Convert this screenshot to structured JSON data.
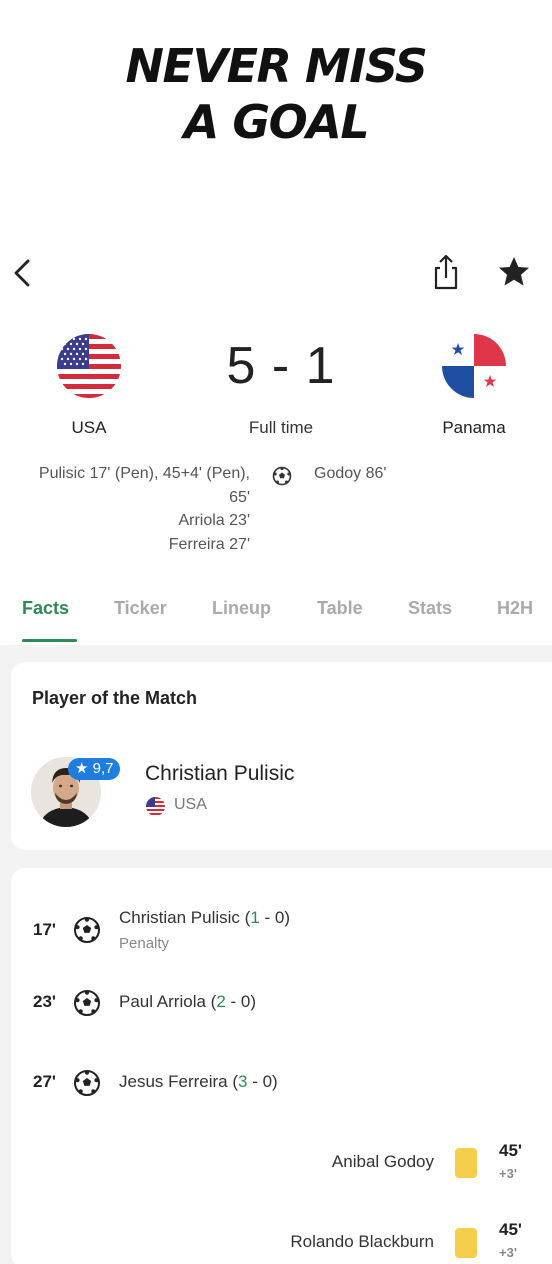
{
  "headline": {
    "line1": "NEVER MISS",
    "line2": "A GOAL"
  },
  "nav": {
    "back_icon": "chevron-left-icon",
    "share_icon": "share-icon",
    "favorite_icon": "star-icon"
  },
  "match": {
    "home_team": "USA",
    "away_team": "Panama",
    "score": "5 - 1",
    "status": "Full time",
    "home_scorers": [
      "Pulisic 17' (Pen), 45+4' (Pen),",
      "65'",
      "Arriola 23'",
      "Ferreira 27'"
    ],
    "away_scorers": [
      "Godoy 86'"
    ]
  },
  "tabs": [
    "Facts",
    "Ticker",
    "Lineup",
    "Table",
    "Stats",
    "H2H"
  ],
  "active_tab": "Facts",
  "player_of_match": {
    "title": "Player of the Match",
    "rating": "★ 9,7",
    "name": "Christian Pulisic",
    "country": "USA"
  },
  "events": [
    {
      "minute": "17'",
      "player": "Christian Pulisic",
      "open": " (",
      "score_home": "1",
      "score_rest": " - 0)",
      "detail": "Penalty"
    },
    {
      "minute": "23'",
      "player": "Paul Arriola",
      "open": " (",
      "score_home": "2",
      "score_rest": " - 0)",
      "detail": ""
    },
    {
      "minute": "27'",
      "player": "Jesus Ferreira",
      "open": " (",
      "score_home": "3",
      "score_rest": " - 0)",
      "detail": ""
    }
  ],
  "cards": [
    {
      "player": "Anibal Godoy",
      "minute": "45'",
      "added": "+3'",
      "type": "yellow"
    },
    {
      "player": "Rolando Blackburn",
      "minute": "45'",
      "added": "+3'",
      "type": "yellow"
    }
  ],
  "colors": {
    "accent": "#2e8b57",
    "rating_badge": "#1f7de0",
    "yellow_card": "#f5cf4b",
    "inactive_tab": "#aaaaaa"
  }
}
